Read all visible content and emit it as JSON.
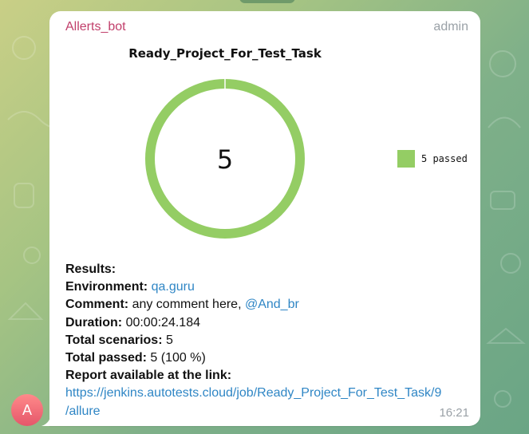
{
  "bubble": {
    "sender": "Allerts_bot",
    "role": "admin",
    "time": "16:21"
  },
  "avatar": {
    "letter": "A"
  },
  "chart_data": {
    "type": "pie",
    "title": "Ready_Project_For_Test_Task",
    "center_label": "5",
    "categories": [
      "passed"
    ],
    "values": [
      5
    ],
    "legend": [
      "5 passed"
    ],
    "legend_position": "right",
    "colors": [
      "#94cd64"
    ]
  },
  "message": {
    "results_label": "Results:",
    "environment_label": "Environment:",
    "environment_value": "qa.guru",
    "comment_label": "Comment:",
    "comment_value": "any comment here,",
    "comment_mention": "@And_br",
    "duration_label": "Duration:",
    "duration_value": "00:00:24.184",
    "total_scenarios_label": "Total scenarios:",
    "total_scenarios_value": "5",
    "total_passed_label": "Total passed:",
    "total_passed_value": "5 (100 %)",
    "report_label": "Report available at the link:",
    "report_link_line1": "https://jenkins.autotests.cloud/job/Ready_Project_For_Test_Task/9",
    "report_link_line2": "/allure"
  },
  "colors": {
    "sender": "#c13f6b",
    "link": "#2f86c5",
    "donut": "#94cd64"
  }
}
